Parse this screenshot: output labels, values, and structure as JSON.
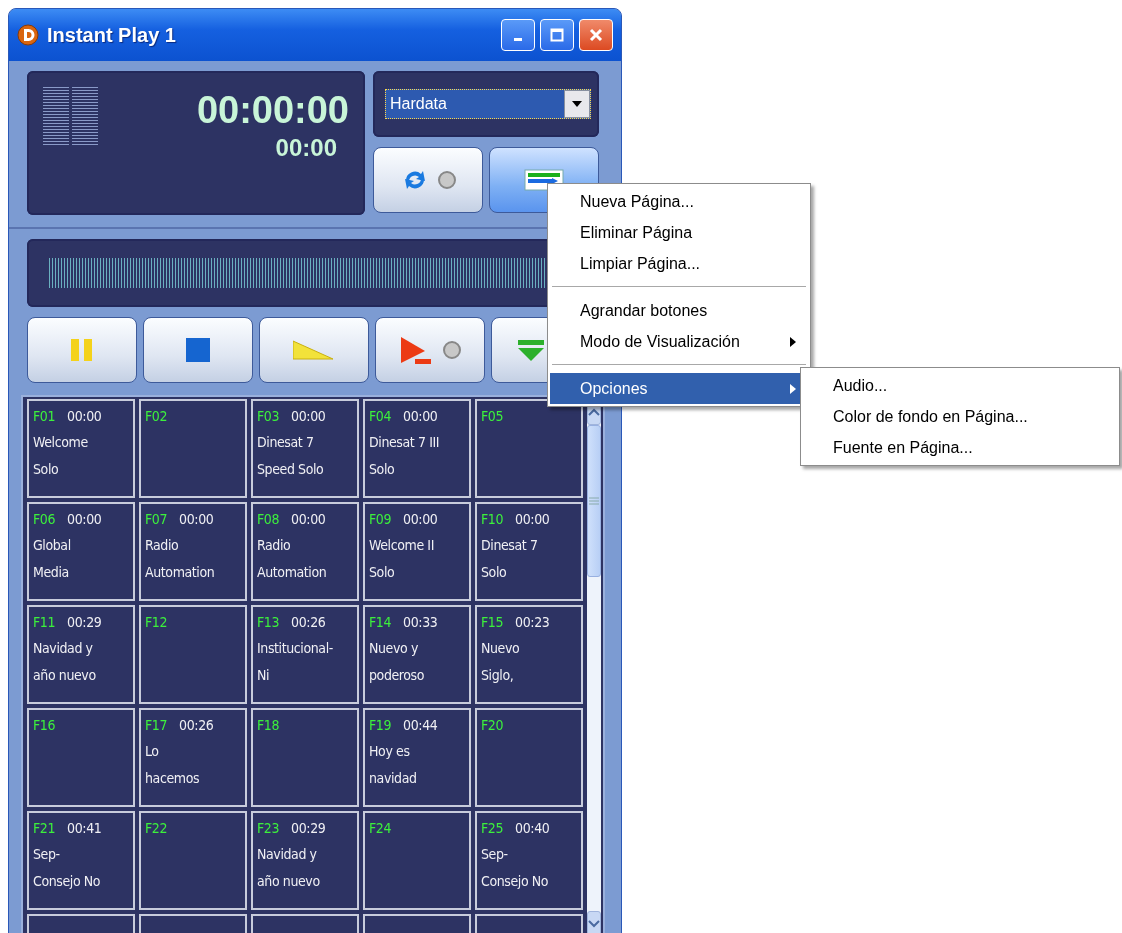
{
  "window": {
    "title": "Instant Play 1"
  },
  "display": {
    "elapsed": "00:00:00",
    "remaining": "00:00"
  },
  "page_selector": {
    "value": "Hardata"
  },
  "page_menu_button": {
    "pressed": true
  },
  "cart_buttons": [
    {
      "key": "F01",
      "time": "00:00",
      "lines": [
        "Welcome",
        "Solo"
      ]
    },
    {
      "key": "F02"
    },
    {
      "key": "F03",
      "time": "00:00",
      "lines": [
        "Dinesat 7",
        "Speed Solo"
      ]
    },
    {
      "key": "F04",
      "time": "00:00",
      "lines": [
        "Dinesat 7 III",
        "Solo"
      ]
    },
    {
      "key": "F05"
    },
    {
      "key": "F06",
      "time": "00:00",
      "lines": [
        "Global",
        "Media"
      ]
    },
    {
      "key": "F07",
      "time": "00:00",
      "lines": [
        "Radio",
        "Automation"
      ]
    },
    {
      "key": "F08",
      "time": "00:00",
      "lines": [
        "Radio",
        "Automation"
      ]
    },
    {
      "key": "F09",
      "time": "00:00",
      "lines": [
        "Welcome II",
        "Solo"
      ]
    },
    {
      "key": "F10",
      "time": "00:00",
      "lines": [
        "Dinesat 7",
        "Solo"
      ]
    },
    {
      "key": "F11",
      "time": "00:29",
      "lines": [
        "Navidad y",
        "año nuevo"
      ]
    },
    {
      "key": "F12"
    },
    {
      "key": "F13",
      "time": "00:26",
      "lines": [
        "Institucional-",
        "Ni"
      ]
    },
    {
      "key": "F14",
      "time": "00:33",
      "lines": [
        "Nuevo y",
        "poderoso"
      ]
    },
    {
      "key": "F15",
      "time": "00:23",
      "lines": [
        "Nuevo",
        "Siglo,"
      ]
    },
    {
      "key": "F16"
    },
    {
      "key": "F17",
      "time": "00:26",
      "lines": [
        "Lo",
        "hacemos"
      ]
    },
    {
      "key": "F18"
    },
    {
      "key": "F19",
      "time": "00:44",
      "lines": [
        "Hoy es",
        "navidad"
      ]
    },
    {
      "key": "F20"
    },
    {
      "key": "F21",
      "time": "00:41",
      "lines": [
        "Sep-",
        "Consejo No"
      ]
    },
    {
      "key": "F22"
    },
    {
      "key": "F23",
      "time": "00:29",
      "lines": [
        "Navidad y",
        "año nuevo"
      ]
    },
    {
      "key": "F24"
    },
    {
      "key": "F25",
      "time": "00:40",
      "lines": [
        "Sep-",
        "Consejo No"
      ]
    }
  ],
  "context_menu": {
    "items": [
      {
        "kind": "item",
        "label": "Nueva Página...",
        "has_submenu": false,
        "selected": false
      },
      {
        "kind": "item",
        "label": "Eliminar Página",
        "has_submenu": false,
        "selected": false
      },
      {
        "kind": "item",
        "label": "Limpiar Página...",
        "has_submenu": false,
        "selected": false
      },
      {
        "kind": "separator"
      },
      {
        "kind": "item",
        "label": "Agrandar botones",
        "has_submenu": false,
        "selected": false
      },
      {
        "kind": "item",
        "label": "Modo de Visualización",
        "has_submenu": true,
        "selected": false
      },
      {
        "kind": "separator"
      },
      {
        "kind": "item",
        "label": "Opciones",
        "has_submenu": true,
        "selected": true
      }
    ]
  },
  "submenu": {
    "items": [
      {
        "kind": "item",
        "label": "Audio...",
        "has_submenu": false,
        "selected": false
      },
      {
        "kind": "item",
        "label": "Color de fondo en Página...",
        "has_submenu": false,
        "selected": false
      },
      {
        "kind": "item",
        "label": "Fuente en Página...",
        "has_submenu": false,
        "selected": false
      }
    ]
  }
}
